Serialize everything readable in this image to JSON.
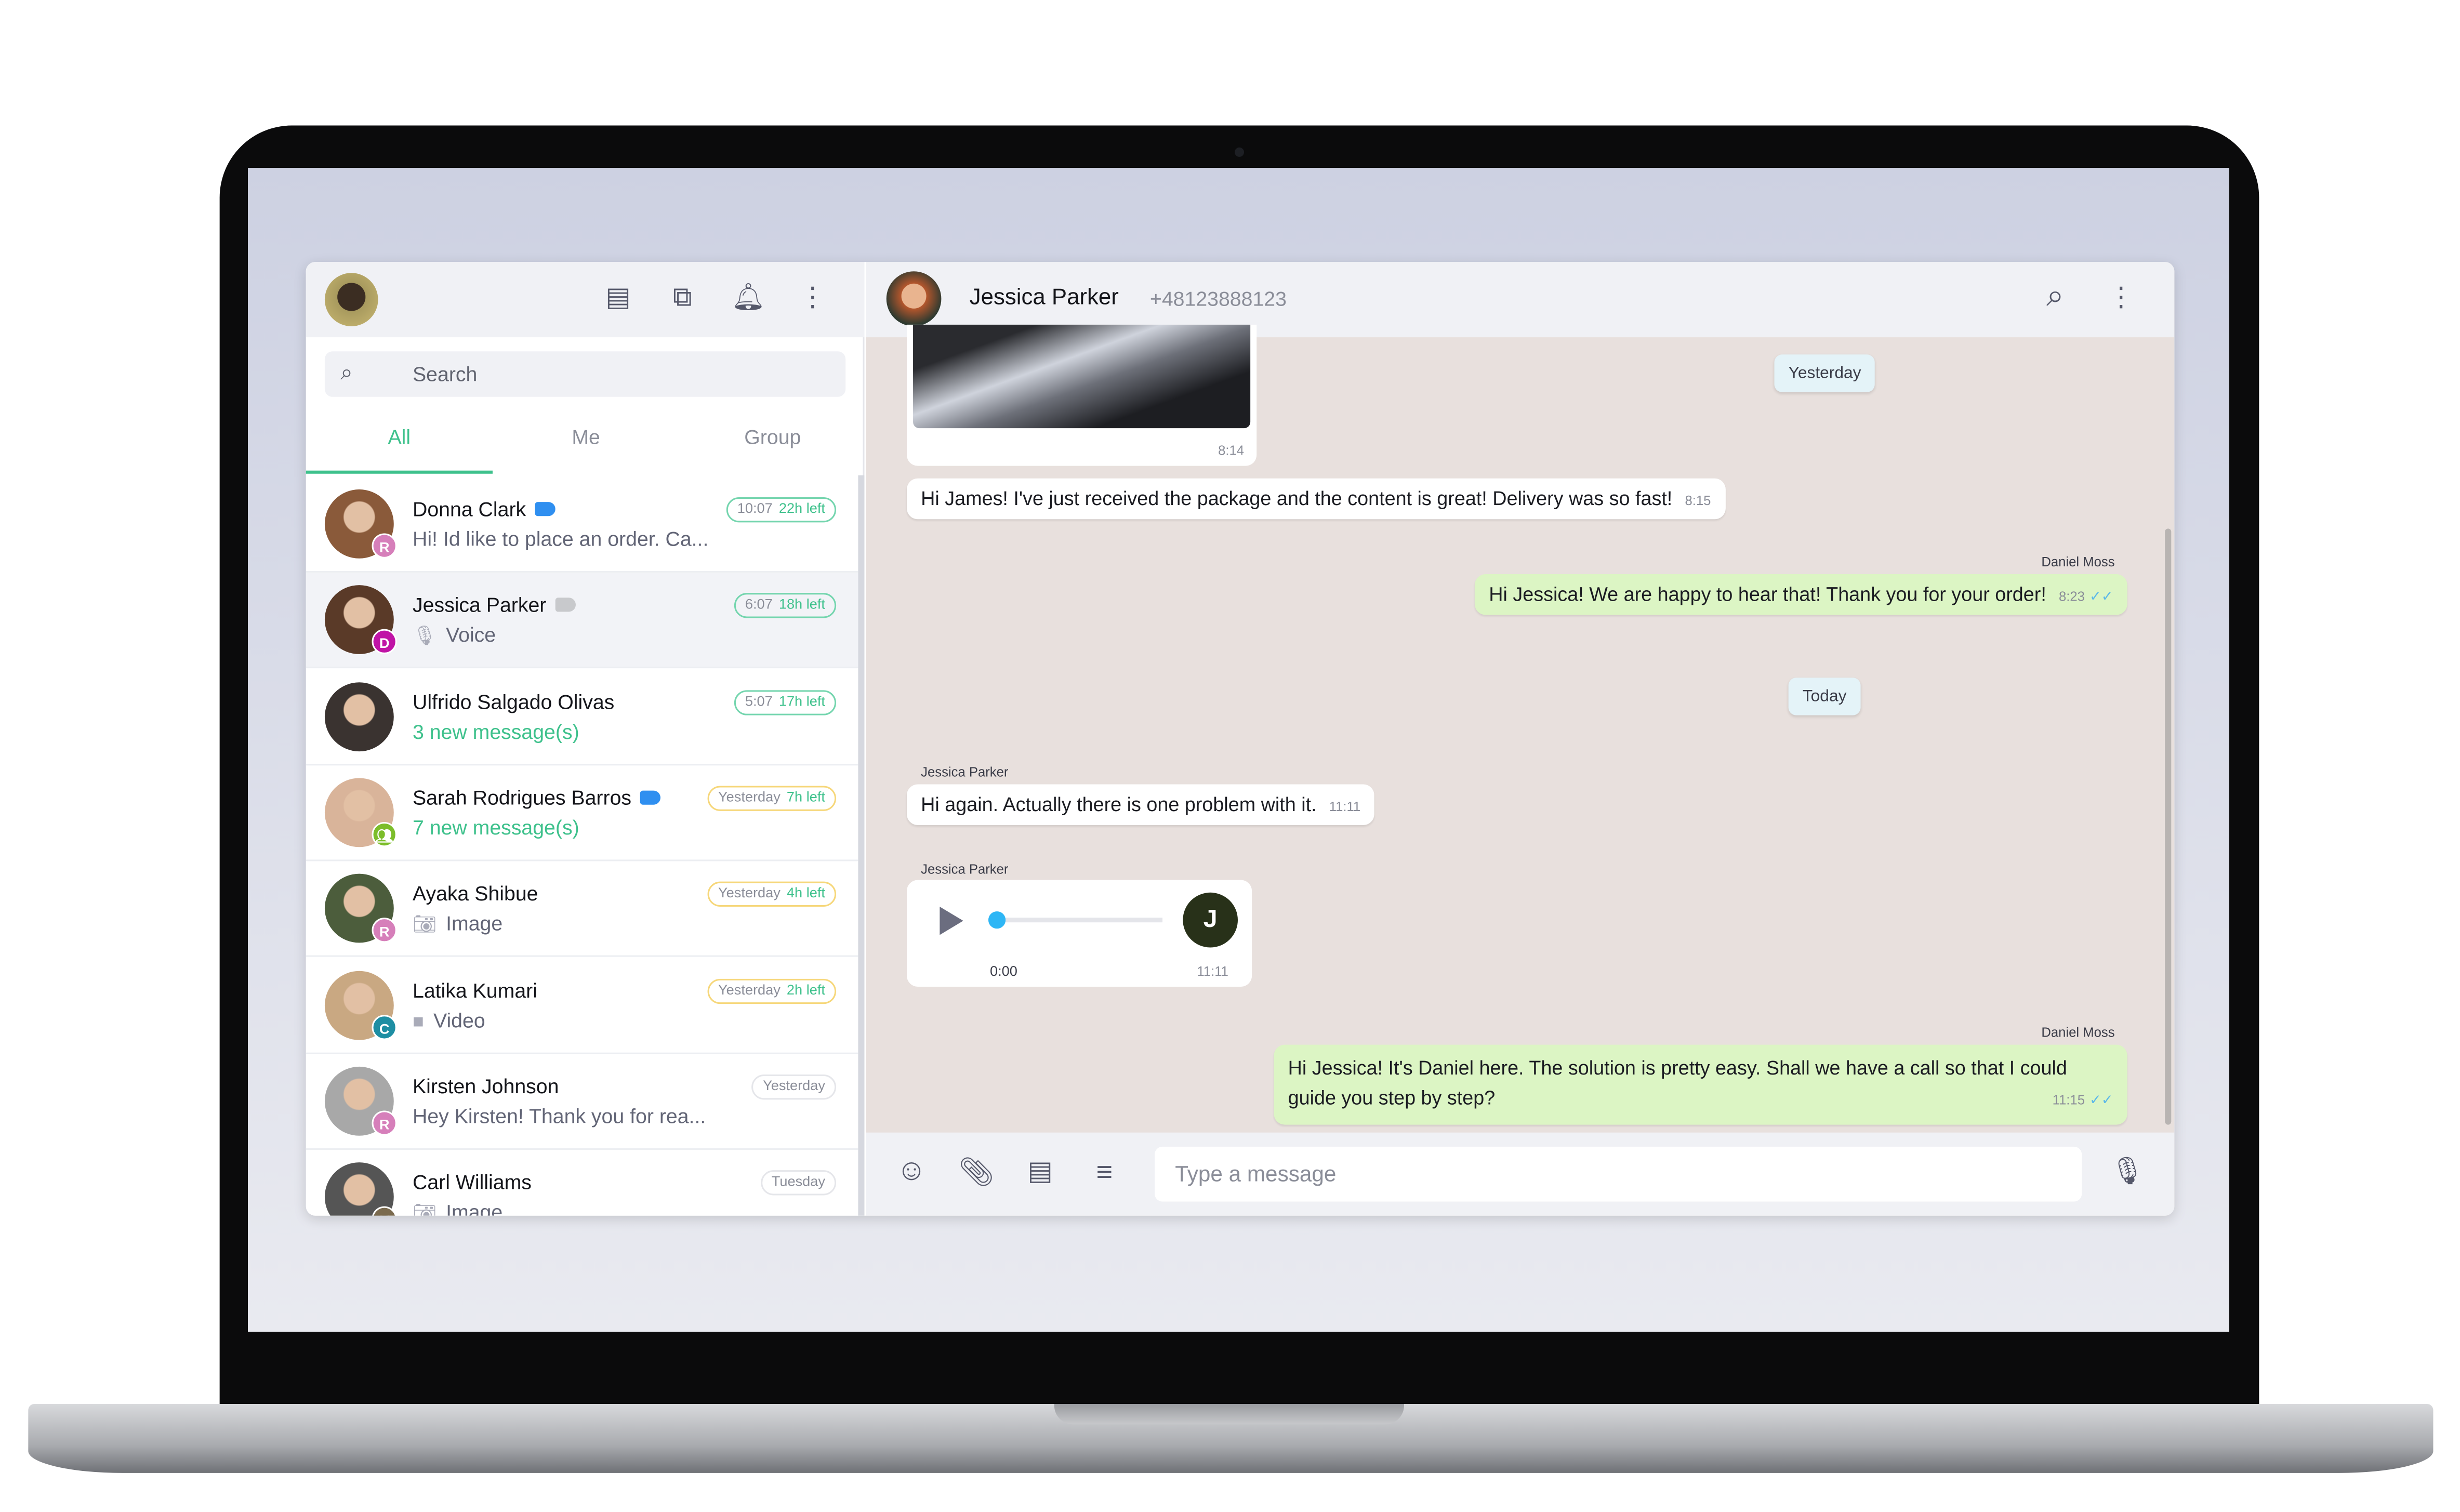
{
  "sidebar": {
    "search_placeholder": "Search",
    "tabs": [
      "All",
      "Me",
      "Group"
    ],
    "active_tab": "All",
    "items": [
      {
        "name": "Donna Clark",
        "preview": "Hi! Id like to place an order. Ca...",
        "time": "10:07",
        "left": "22h left",
        "badge": "R",
        "badge_color": "#d67fba",
        "tag_color": "#2f8ff0",
        "pill": "green",
        "selected": false
      },
      {
        "name": "Jessica Parker",
        "preview": "Voice",
        "preview_icon": "mic-icon",
        "time": "6:07",
        "left": "18h left",
        "badge": "D",
        "badge_color": "#c014a6",
        "tag_color": "#c8c9cc",
        "pill": "green",
        "selected": true
      },
      {
        "name": "Ulfrido Salgado Olivas",
        "preview": "3 new message(s)",
        "time": "5:07",
        "left": "17h left",
        "pill": "green",
        "new": true
      },
      {
        "name": "Sarah Rodrigues Barros",
        "preview": "7 new message(s)",
        "time": "Yesterday",
        "left": "7h left",
        "badge": "group-icon",
        "badge_color": "#7cbd2b",
        "tag_color": "#2f8ff0",
        "pill": "yellow",
        "new": true
      },
      {
        "name": "Ayaka Shibue",
        "preview": "Image",
        "preview_icon": "camera-icon",
        "time": "Yesterday",
        "left": "4h left",
        "badge": "R",
        "badge_color": "#d67fba",
        "pill": "yellow"
      },
      {
        "name": "Latika Kumari",
        "preview": "Video",
        "preview_icon": "video-icon",
        "time": "Yesterday",
        "left": "2h left",
        "badge": "C",
        "badge_color": "#1e8ea3",
        "pill": "yellow"
      },
      {
        "name": "Kirsten Johnson",
        "preview": "Hey Kirsten! Thank you for rea...",
        "time": "Yesterday",
        "badge": "R",
        "badge_color": "#d67fba",
        "pill": "gray"
      },
      {
        "name": "Carl Williams",
        "preview": "Image",
        "preview_icon": "camera-icon",
        "time": "Tuesday",
        "badge": "K",
        "badge_color": "#7a6a4e",
        "pill": "gray"
      }
    ]
  },
  "chat": {
    "contact_name": "Jessica Parker",
    "phone": "+48123888123",
    "image_time": "8:14",
    "date_yesterday": "Yesterday",
    "date_today": "Today",
    "messages": [
      {
        "text": "Hi James! I've just received the package and the content is great! Delivery was so fast!",
        "time": "8:15"
      },
      {
        "sender": "Daniel Moss",
        "text": "Hi Jessica! We are happy to hear that! Thank you for your order!",
        "time": "8:23"
      },
      {
        "sender": "Jessica Parker",
        "text": "Hi again. Actually there is one problem with it.",
        "time": "11:11"
      },
      {
        "sender": "Jessica Parker",
        "voice_elapsed": "0:00",
        "time": "11:11",
        "avatar_letter": "J",
        "progress": 0
      },
      {
        "sender": "Daniel Moss",
        "text_line1": "Hi Jessica! It's Daniel here. The solution is pretty easy. Shall we have a call so that I could",
        "text_line2": "guide you step by step?",
        "time": "11:15"
      }
    ],
    "input_placeholder": "Type a message"
  },
  "colors": {
    "accent": "#3ec18c",
    "chat_bg": "#e8e0dd",
    "outgoing": "#dcf5c4"
  }
}
